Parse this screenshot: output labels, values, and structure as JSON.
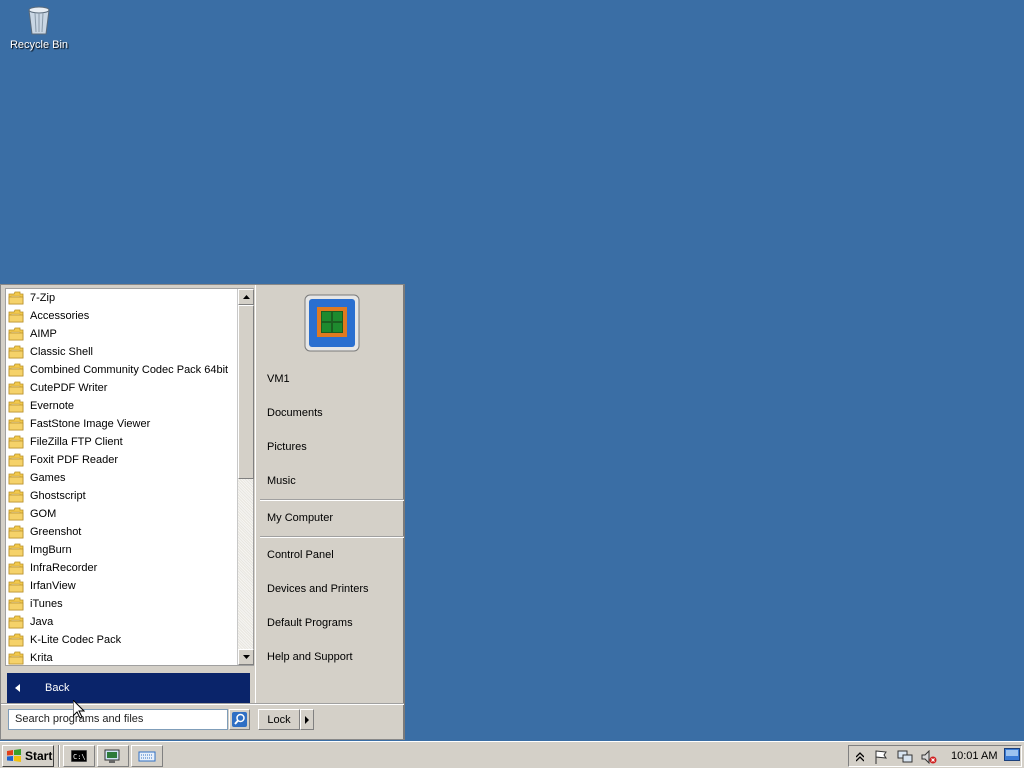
{
  "desktop": {
    "background_color": "#3a6ea5",
    "icons": [
      {
        "label": "Recycle Bin",
        "icon": "recycle-bin-icon"
      }
    ]
  },
  "start_menu": {
    "programs": [
      "7-Zip",
      "Accessories",
      "AIMP",
      "Classic Shell",
      "Combined Community Codec Pack 64bit",
      "CutePDF Writer",
      "Evernote",
      "FastStone Image Viewer",
      "FileZilla FTP Client",
      "Foxit PDF Reader",
      "Games",
      "Ghostscript",
      "GOM",
      "Greenshot",
      "ImgBurn",
      "InfraRecorder",
      "IrfanView",
      "iTunes",
      "Java",
      "K-Lite Codec Pack",
      "Krita"
    ],
    "back_label": "Back",
    "search_placeholder": "Search programs and files",
    "right_pane": {
      "user": "VM1",
      "documents": "Documents",
      "pictures": "Pictures",
      "music": "Music",
      "my_computer": "My Computer",
      "control_panel": "Control Panel",
      "devices_printers": "Devices and Printers",
      "default_programs": "Default Programs",
      "help_support": "Help and Support"
    },
    "lock_label": "Lock",
    "highlight_color": "#0a246a"
  },
  "taskbar": {
    "start_label": "Start",
    "clock": "10:01 AM",
    "quick_launch": [
      "cmd-icon",
      "computer-icon",
      "keyboard-icon"
    ],
    "tray": [
      "show-hidden-icon",
      "flag-icon",
      "network-icon",
      "volume-muted-icon"
    ]
  }
}
